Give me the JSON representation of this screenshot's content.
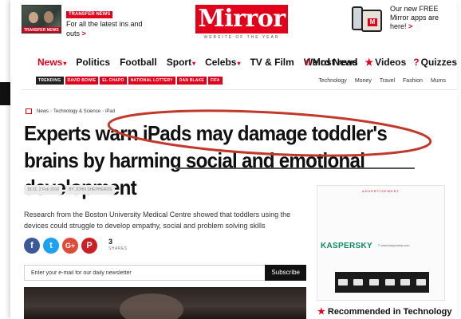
{
  "header": {
    "promo": {
      "badge": "TRANSFER NEWS",
      "thumb_strip": "TRANSFER NEWS",
      "copy": "For all the latest ins and outs",
      "chevron": ">"
    },
    "logo": {
      "word": "Mirror",
      "tagline": "WEBSITE OF THE YEAR"
    },
    "app_promo": {
      "phone_letter": "M",
      "copy": "Our new FREE Mirror apps are here!",
      "chevron": ">"
    }
  },
  "nav": {
    "items": [
      {
        "label": "News",
        "caret": "▾"
      },
      {
        "label": "Politics",
        "caret": ""
      },
      {
        "label": "Football",
        "caret": ""
      },
      {
        "label": "Sport",
        "caret": "▾"
      },
      {
        "label": "Celebs",
        "caret": "▾"
      },
      {
        "label": "TV & Film",
        "caret": ""
      },
      {
        "label": "Weird News",
        "caret": ""
      }
    ],
    "right": [
      {
        "icon": "ıl",
        "label": "Most read"
      },
      {
        "icon": "★",
        "label": "Videos"
      },
      {
        "icon": "?",
        "label": "Quizzes"
      }
    ]
  },
  "subnav": {
    "trending_label": "TRENDING",
    "tags": [
      "DAVID BOWIE",
      "EL CHAPO",
      "NATIONAL LOTTERY",
      "DAN BLAKE",
      "FIFA"
    ],
    "right": [
      "Technology",
      "Money",
      "Travel",
      "Fashion",
      "Mums"
    ]
  },
  "breadcrumb": {
    "parts": [
      "News",
      "Technology & Science",
      "iPad"
    ],
    "sep": "›"
  },
  "article": {
    "headline": "Experts warn iPads may damage toddler's brains by harming social and emotional development",
    "byline": [
      "18:11, 2 Feb 2016",
      "BY JOHN SHEPHERDS"
    ],
    "standfirst": "Research from the Boston University Medical Centre showed that toddlers using the devices could struggle to develop empathy, social and problem solving skills",
    "share": {
      "fb": "f",
      "tw": "t",
      "gp": "G+",
      "pi": "P",
      "count": "3",
      "count_label": "SHARES"
    },
    "newsletter": {
      "placeholder": "Enter your e-mail for our daily newsletter",
      "button": "Subscribe"
    }
  },
  "sidebar": {
    "ad": {
      "label": "ADVERTISEMENT",
      "brand": "KASPERSKY",
      "brand_mark": "≡",
      "url": "www.kaspersky.com"
    },
    "recommended": {
      "icon": "★",
      "label": "Recommended in Technology"
    }
  },
  "colors": {
    "brand_red": "#e3001b",
    "facebook": "#3b5998",
    "twitter": "#1da1f2",
    "google": "#dd4b39",
    "pinterest": "#cb2027",
    "annotation_ellipse": "#c0392b"
  }
}
